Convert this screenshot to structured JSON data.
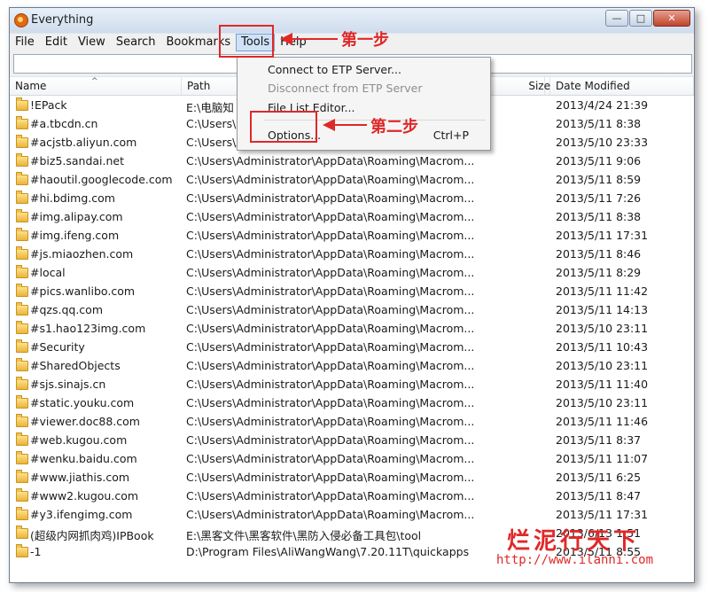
{
  "window": {
    "title": "Everything"
  },
  "menubar": [
    "File",
    "Edit",
    "View",
    "Search",
    "Bookmarks",
    "Tools",
    "Help"
  ],
  "search": {
    "value": ""
  },
  "columns": {
    "name": "Name",
    "path": "Path",
    "size": "Size",
    "date": "Date Modified"
  },
  "tools_menu": {
    "items": [
      {
        "label": "Connect to ETP Server...",
        "disabled": false
      },
      {
        "label": "Disconnect from ETP Server",
        "disabled": true
      },
      {
        "label": "File List Editor...",
        "disabled": false
      },
      {
        "label": "Options...",
        "disabled": false,
        "shortcut": "Ctrl+P"
      }
    ]
  },
  "rows": [
    {
      "name": "!EPack",
      "path": "E:\\电脑知",
      "date": "2013/4/24 21:39"
    },
    {
      "name": "#a.tbcdn.cn",
      "path": "C:\\Users\\",
      "date": "2013/5/11 8:38"
    },
    {
      "name": "#acjstb.aliyun.com",
      "path": "C:\\Users\\Administrator\\AppData\\Roaming\\Macrom...",
      "date": "2013/5/10 23:33"
    },
    {
      "name": "#biz5.sandai.net",
      "path": "C:\\Users\\Administrator\\AppData\\Roaming\\Macrom...",
      "date": "2013/5/11 9:06"
    },
    {
      "name": "#haoutil.googlecode.com",
      "path": "C:\\Users\\Administrator\\AppData\\Roaming\\Macrom...",
      "date": "2013/5/11 8:59"
    },
    {
      "name": "#hi.bdimg.com",
      "path": "C:\\Users\\Administrator\\AppData\\Roaming\\Macrom...",
      "date": "2013/5/11 7:26"
    },
    {
      "name": "#img.alipay.com",
      "path": "C:\\Users\\Administrator\\AppData\\Roaming\\Macrom...",
      "date": "2013/5/11 8:38"
    },
    {
      "name": "#img.ifeng.com",
      "path": "C:\\Users\\Administrator\\AppData\\Roaming\\Macrom...",
      "date": "2013/5/11 17:31"
    },
    {
      "name": "#js.miaozhen.com",
      "path": "C:\\Users\\Administrator\\AppData\\Roaming\\Macrom...",
      "date": "2013/5/11 8:46"
    },
    {
      "name": "#local",
      "path": "C:\\Users\\Administrator\\AppData\\Roaming\\Macrom...",
      "date": "2013/5/11 8:29"
    },
    {
      "name": "#pics.wanlibo.com",
      "path": "C:\\Users\\Administrator\\AppData\\Roaming\\Macrom...",
      "date": "2013/5/11 11:42"
    },
    {
      "name": "#qzs.qq.com",
      "path": "C:\\Users\\Administrator\\AppData\\Roaming\\Macrom...",
      "date": "2013/5/11 14:13"
    },
    {
      "name": "#s1.hao123img.com",
      "path": "C:\\Users\\Administrator\\AppData\\Roaming\\Macrom...",
      "date": "2013/5/10 23:11"
    },
    {
      "name": "#Security",
      "path": "C:\\Users\\Administrator\\AppData\\Roaming\\Macrom...",
      "date": "2013/5/11 10:43"
    },
    {
      "name": "#SharedObjects",
      "path": "C:\\Users\\Administrator\\AppData\\Roaming\\Macrom...",
      "date": "2013/5/10 23:11"
    },
    {
      "name": "#sjs.sinajs.cn",
      "path": "C:\\Users\\Administrator\\AppData\\Roaming\\Macrom...",
      "date": "2013/5/11 11:40"
    },
    {
      "name": "#static.youku.com",
      "path": "C:\\Users\\Administrator\\AppData\\Roaming\\Macrom...",
      "date": "2013/5/10 23:11"
    },
    {
      "name": "#viewer.doc88.com",
      "path": "C:\\Users\\Administrator\\AppData\\Roaming\\Macrom...",
      "date": "2013/5/11 11:46"
    },
    {
      "name": "#web.kugou.com",
      "path": "C:\\Users\\Administrator\\AppData\\Roaming\\Macrom...",
      "date": "2013/5/11 8:37"
    },
    {
      "name": "#wenku.baidu.com",
      "path": "C:\\Users\\Administrator\\AppData\\Roaming\\Macrom...",
      "date": "2013/5/11 11:07"
    },
    {
      "name": "#www.jiathis.com",
      "path": "C:\\Users\\Administrator\\AppData\\Roaming\\Macrom...",
      "date": "2013/5/11 6:25"
    },
    {
      "name": "#www2.kugou.com",
      "path": "C:\\Users\\Administrator\\AppData\\Roaming\\Macrom...",
      "date": "2013/5/11 8:47"
    },
    {
      "name": "#y3.ifengimg.com",
      "path": "C:\\Users\\Administrator\\AppData\\Roaming\\Macrom...",
      "date": "2013/5/11 17:31"
    },
    {
      "name": "(超级内网抓肉鸡)IPBook",
      "path": "E:\\黑客文件\\黑客软件\\黑防入侵必备工具包\\tool",
      "date": "2013/6/13 1:51"
    },
    {
      "name": "-1",
      "path": "D:\\Program Files\\AliWangWang\\7.20.11T\\quickapps",
      "date": "2013/5/11 8:55"
    }
  ],
  "annotations": {
    "step1": "第一步",
    "step2": "第二步"
  },
  "watermark": {
    "text": "烂泥行天下",
    "url": "http://www.ilanni.com"
  },
  "colors": {
    "accent_red": "#e02828",
    "menu_highlight": "#cfe2f7"
  }
}
